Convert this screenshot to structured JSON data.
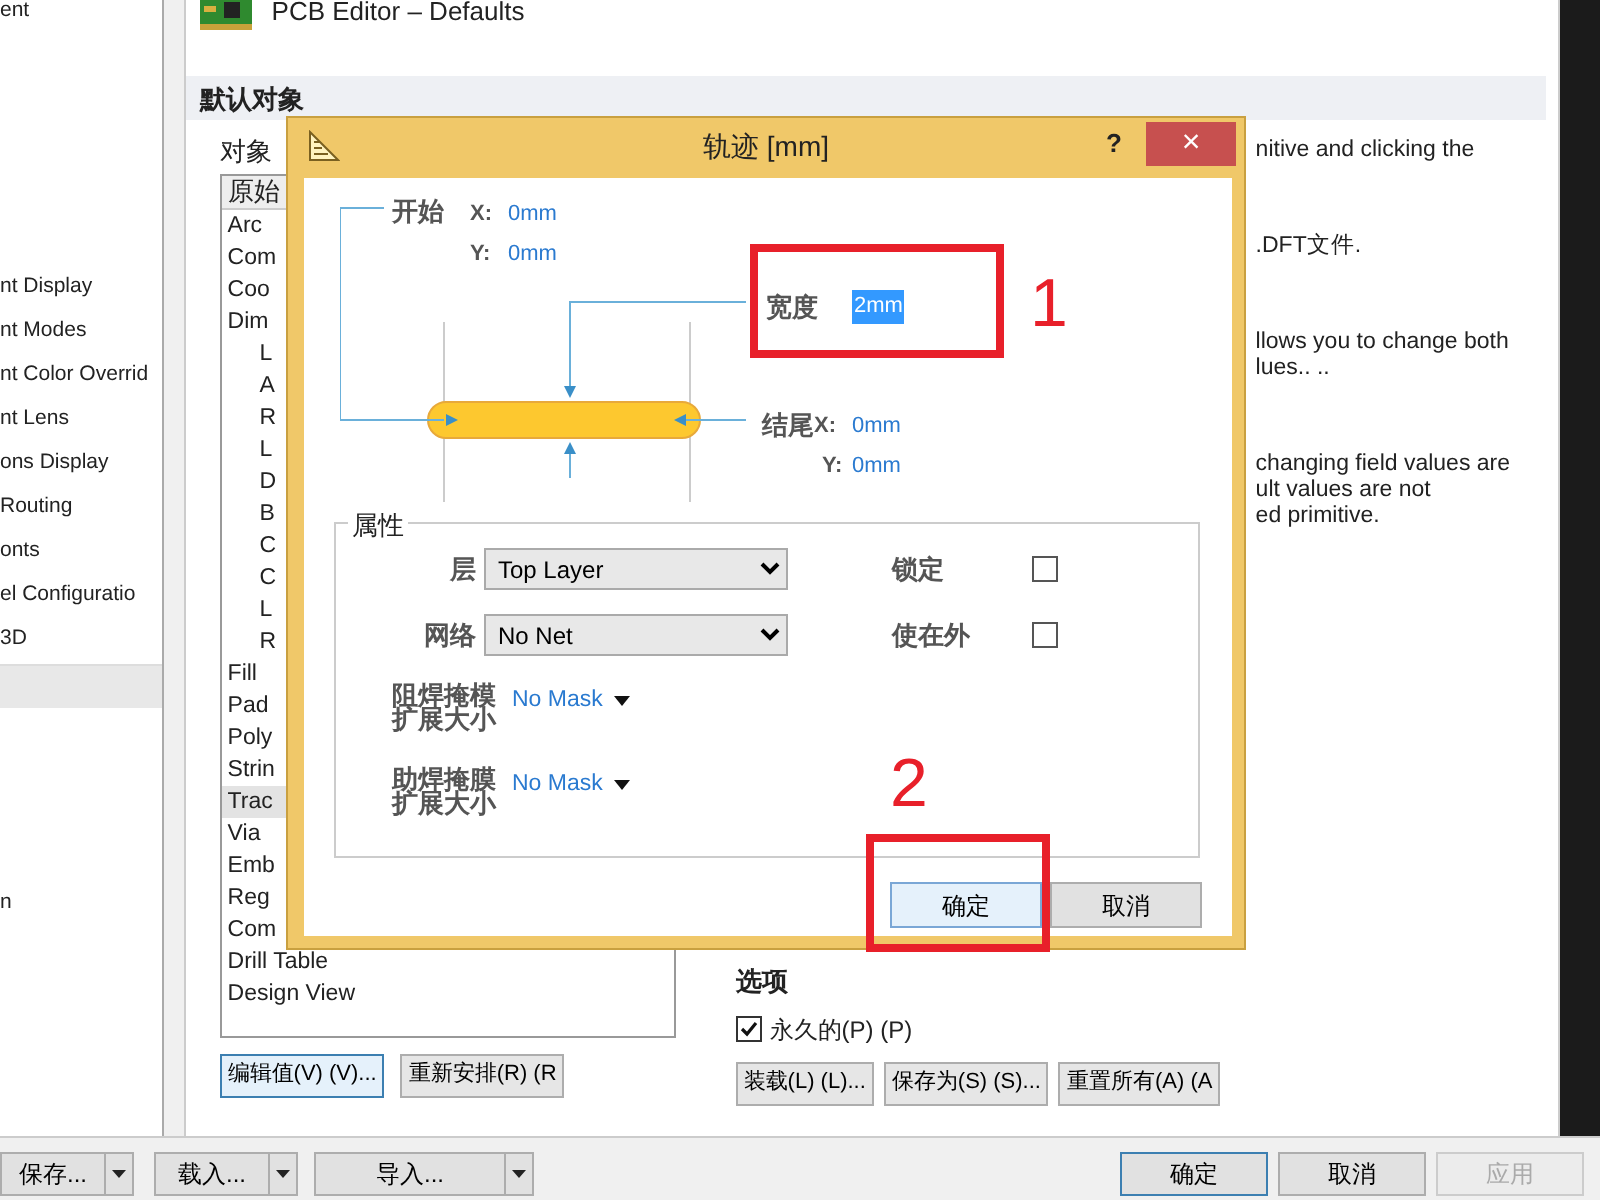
{
  "left_panel": {
    "items": [
      {
        "label": "ent"
      },
      {
        "label": "nt Display"
      },
      {
        "label": "nt Modes"
      },
      {
        "label": "nt Color Overrid"
      },
      {
        "label": "nt Lens"
      },
      {
        "label": "ons Display"
      },
      {
        "label": "Routing"
      },
      {
        "label": "onts"
      },
      {
        "label": "el Configuratio"
      },
      {
        "label": "3D"
      },
      {
        "label": "n"
      }
    ]
  },
  "main": {
    "title": "PCB Editor – Defaults",
    "section": "默认对象",
    "objects_label": "对象",
    "objects": [
      {
        "label": "原始",
        "kind": "header"
      },
      {
        "label": "Arc",
        "kind": "item",
        "selected": false
      },
      {
        "label": "Com",
        "kind": "item",
        "selected": false
      },
      {
        "label": "Coo",
        "kind": "item",
        "selected": false
      },
      {
        "label": "Dim",
        "kind": "item",
        "selected": false
      },
      {
        "label": "L",
        "kind": "child",
        "selected": false
      },
      {
        "label": "A",
        "kind": "child",
        "selected": false
      },
      {
        "label": "R",
        "kind": "child",
        "selected": false
      },
      {
        "label": "L",
        "kind": "child",
        "selected": false
      },
      {
        "label": "D",
        "kind": "child",
        "selected": false
      },
      {
        "label": "B",
        "kind": "child",
        "selected": false
      },
      {
        "label": "C",
        "kind": "child",
        "selected": false
      },
      {
        "label": "C",
        "kind": "child",
        "selected": false
      },
      {
        "label": "L",
        "kind": "child",
        "selected": false
      },
      {
        "label": "R",
        "kind": "child",
        "selected": false
      },
      {
        "label": "Fill",
        "kind": "item",
        "selected": false
      },
      {
        "label": "Pad",
        "kind": "item",
        "selected": false
      },
      {
        "label": "Poly",
        "kind": "item",
        "selected": false
      },
      {
        "label": "Strin",
        "kind": "item",
        "selected": false
      },
      {
        "label": "Trac",
        "kind": "item",
        "selected": true
      },
      {
        "label": "Via",
        "kind": "item",
        "selected": false
      },
      {
        "label": "Emb",
        "kind": "item",
        "selected": false
      },
      {
        "label": "Reg",
        "kind": "item",
        "selected": false
      },
      {
        "label": "Com",
        "kind": "item",
        "selected": false
      },
      {
        "label": "Drill Table",
        "kind": "item",
        "selected": false
      },
      {
        "label": "Design View",
        "kind": "item",
        "selected": false
      }
    ],
    "list_buttons": [
      "编辑值(V) (V)...",
      "重新安排(R) (R"
    ],
    "description": [
      [
        "nitive and clicking the"
      ],
      [
        ".DFT文件."
      ],
      [
        "llows you to change both",
        "lues.. .."
      ],
      [
        "changing field values are",
        "ult values are not",
        "ed primitive."
      ]
    ],
    "options_title": "选项",
    "permanent": {
      "label": "永久的(P) (P)",
      "checked": true
    },
    "option_buttons": [
      "装载(L) (L)...",
      "保存为(S) (S)...",
      "重置所有(A) (A"
    ]
  },
  "bottom_bar": {
    "left_buttons": [
      "保存...",
      "载入...",
      "导入..."
    ],
    "right_buttons": [
      {
        "label": "确定",
        "disabled": false,
        "selected": true
      },
      {
        "label": "取消",
        "disabled": false,
        "selected": false
      },
      {
        "label": "应用",
        "disabled": true,
        "selected": false
      }
    ]
  },
  "dialog": {
    "title": "轨迹 [mm]",
    "help": "?",
    "close": "×",
    "start": {
      "label": "开始",
      "x_label": "X:",
      "x": "0mm",
      "y_label": "Y:",
      "y": "0mm"
    },
    "width": {
      "label": "宽度",
      "value": "2mm"
    },
    "end": {
      "label": "结尾",
      "x_label": "X:",
      "x": "0mm",
      "y_label": "Y:",
      "y": "0mm"
    },
    "properties": {
      "title": "属性",
      "layer_label": "层",
      "layer": "Top Layer",
      "net_label": "网络",
      "net": "No Net",
      "locked_label": "锁定",
      "locked": false,
      "keepout_label": "使在外",
      "keepout": false,
      "masks": [
        {
          "label": "阻焊掩模",
          "label2": "扩展大小",
          "value": "No Mask"
        },
        {
          "label": "助焊掩膜",
          "label2": "扩展大小",
          "value": "No Mask"
        }
      ]
    },
    "buttons": [
      {
        "label": "确定",
        "selected": true
      },
      {
        "label": "取消",
        "selected": false
      }
    ]
  },
  "annotations": [
    {
      "number": "1"
    },
    {
      "number": "2"
    }
  ]
}
